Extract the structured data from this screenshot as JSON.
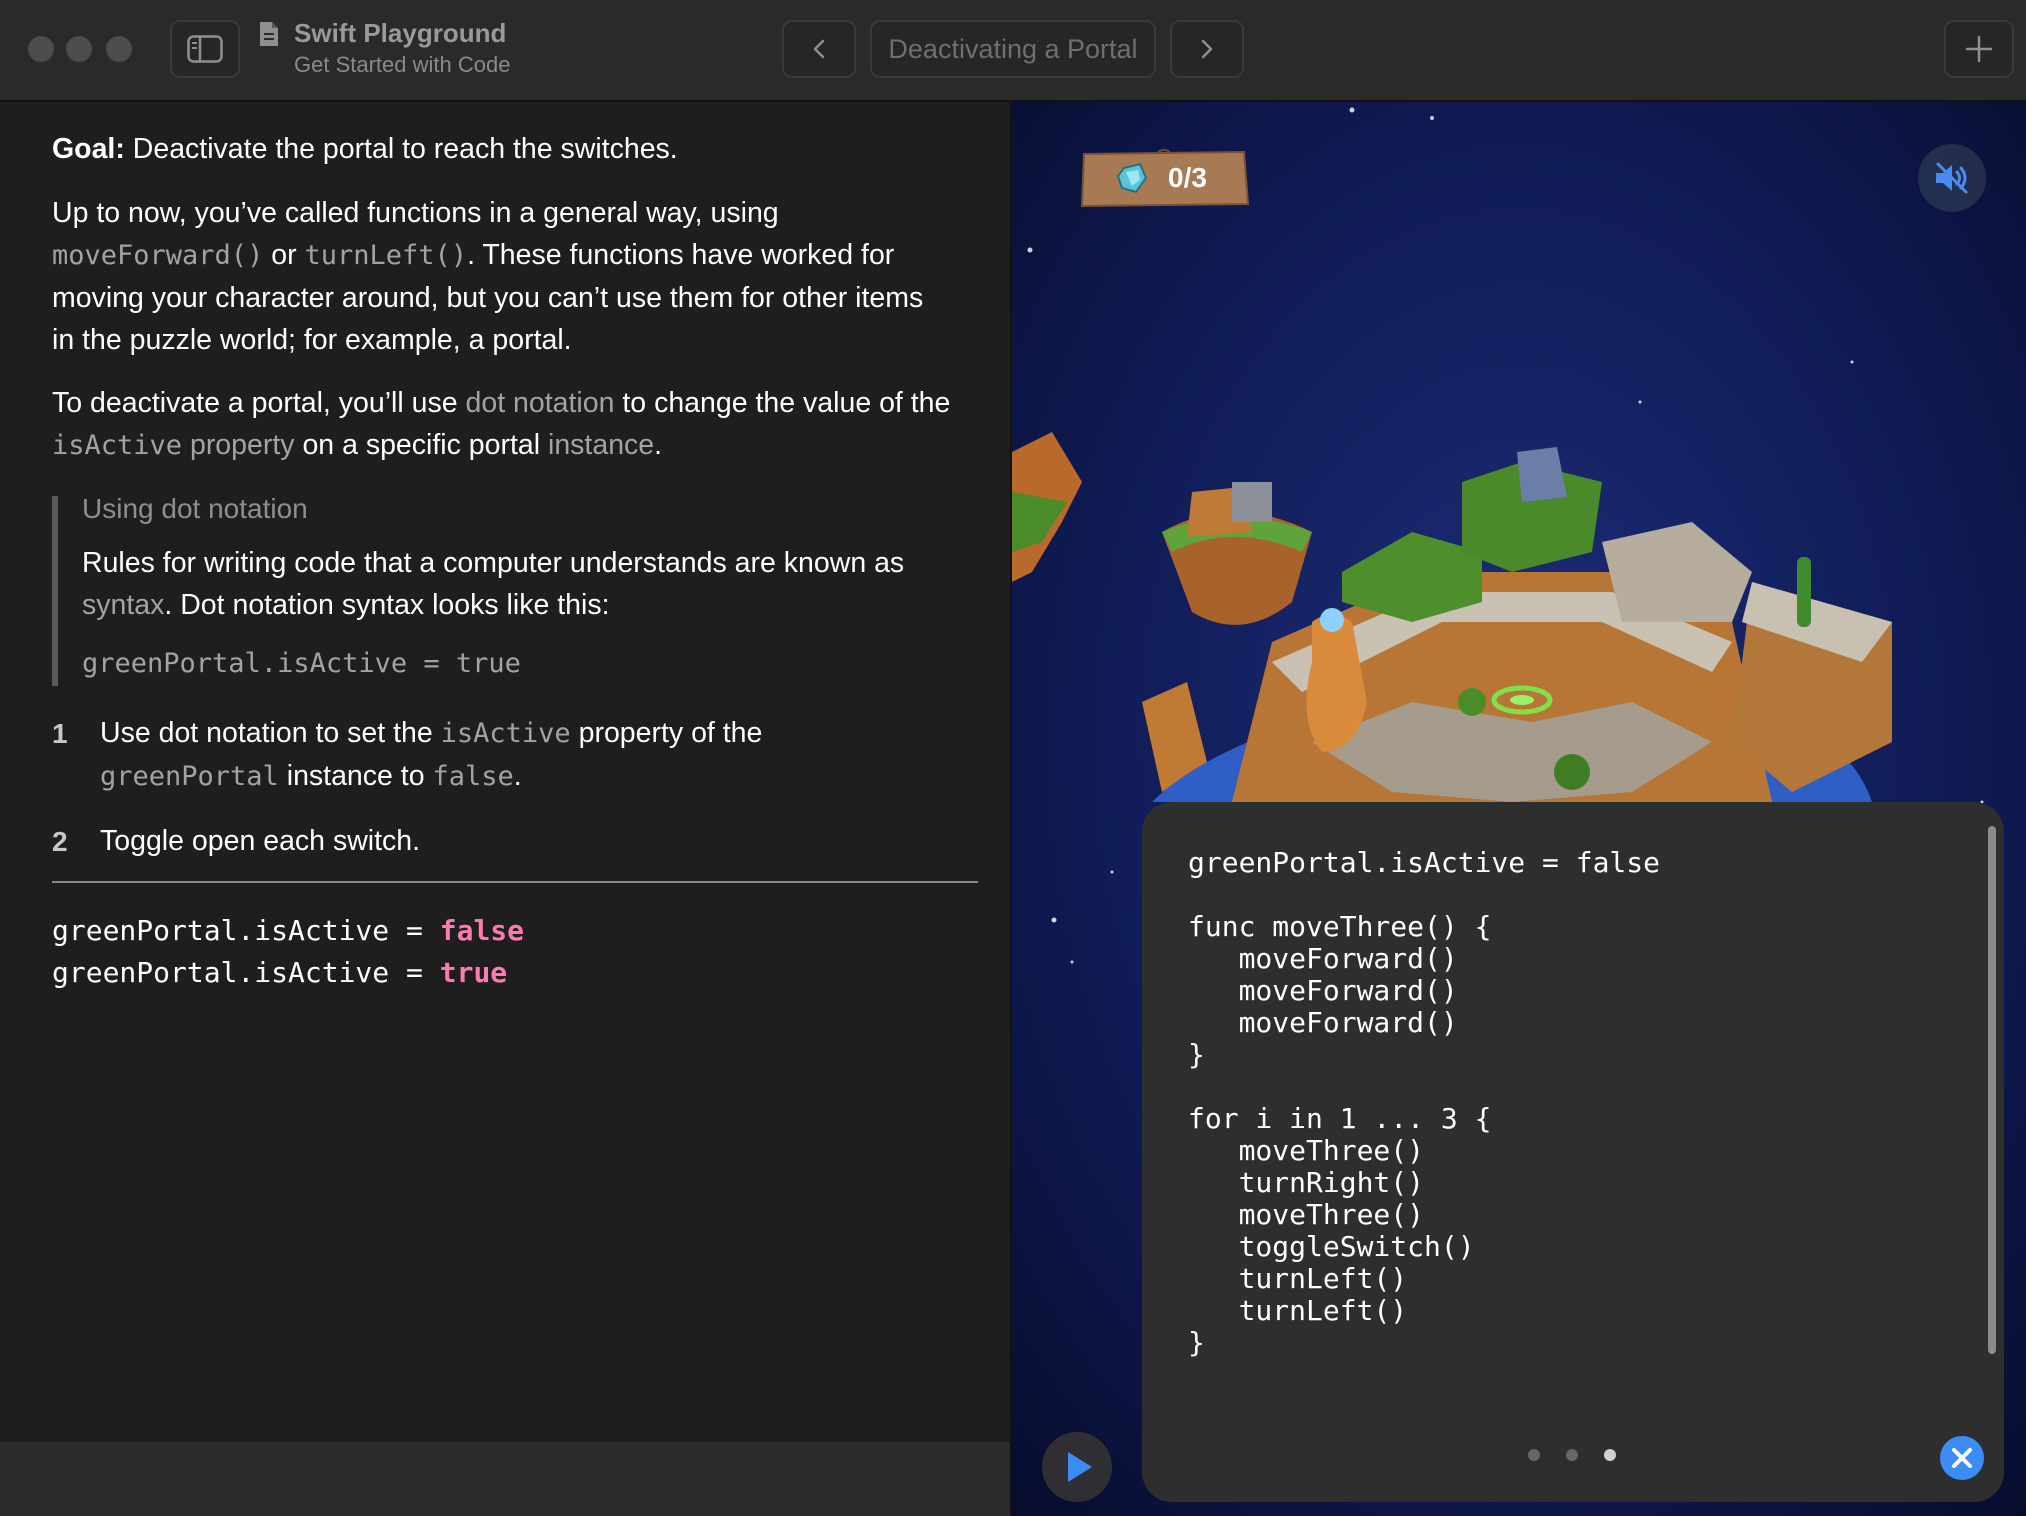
{
  "window": {
    "title": "Swift Playground",
    "subtitle": "Get Started with Code",
    "page_title": "Deactivating a Portal"
  },
  "icons": {
    "sidebar": "sidebar-icon",
    "document": "document-icon",
    "back": "chevron-left-icon",
    "forward": "chevron-right-icon",
    "add": "plus-icon",
    "gem": "gem-icon",
    "mute": "speaker-muted-icon",
    "run": "play-icon",
    "close": "close-icon"
  },
  "instructions": {
    "goal_label": "Goal:",
    "goal_text": " Deactivate the portal to reach the switches.",
    "p1": {
      "a": "Up to now, you’ve called functions in a general way, using",
      "code1": "moveForward()",
      "b": " or ",
      "code2": "turnLeft()",
      "c": ". These functions have worked for",
      "d": "moving your character around, but you can’t use them for other items",
      "e": "in the puzzle world; for example, a portal."
    },
    "p2": {
      "a": "To deactivate a portal, you’ll use ",
      "term1": "dot notation",
      "b": " to change the value of the",
      "code1": "isActive",
      "term2": " property",
      "c": " on a specific portal ",
      "term3": "instance",
      "d": "."
    },
    "callout": {
      "title": "Using dot notation",
      "line1": "Rules for writing code that a computer understands are known as",
      "term": "syntax",
      "line2_rest": ". Dot notation syntax looks like this:",
      "code": "greenPortal.isActive = true"
    },
    "steps": [
      {
        "num": "1",
        "a": "Use dot notation to set the ",
        "code1": "isActive",
        "b": " property of the",
        "code2": "greenPortal",
        "c": " instance to ",
        "code3": "false",
        "d": "."
      },
      {
        "num": "2",
        "text": "Toggle open each switch."
      }
    ],
    "code_lines": [
      {
        "prefix": "greenPortal.isActive = ",
        "keyword": "false"
      },
      {
        "prefix": "greenPortal.isActive = ",
        "keyword": "true"
      }
    ]
  },
  "scene": {
    "score": "0/3",
    "code_panel_lines": [
      "greenPortal.isActive = false",
      "",
      "func moveThree() {",
      "   moveForward()",
      "   moveForward()",
      "   moveForward()",
      "}",
      "",
      "for i in 1 ... 3 {",
      "   moveThree()",
      "   turnRight()",
      "   moveThree()",
      "   toggleSwitch()",
      "   turnLeft()",
      "   turnLeft()",
      "}"
    ],
    "page_dots": {
      "total": 3,
      "active": 3
    }
  },
  "colors": {
    "keyword": "#ff7ab2",
    "accent": "#3b8cf5",
    "sky": "#0d1745"
  }
}
